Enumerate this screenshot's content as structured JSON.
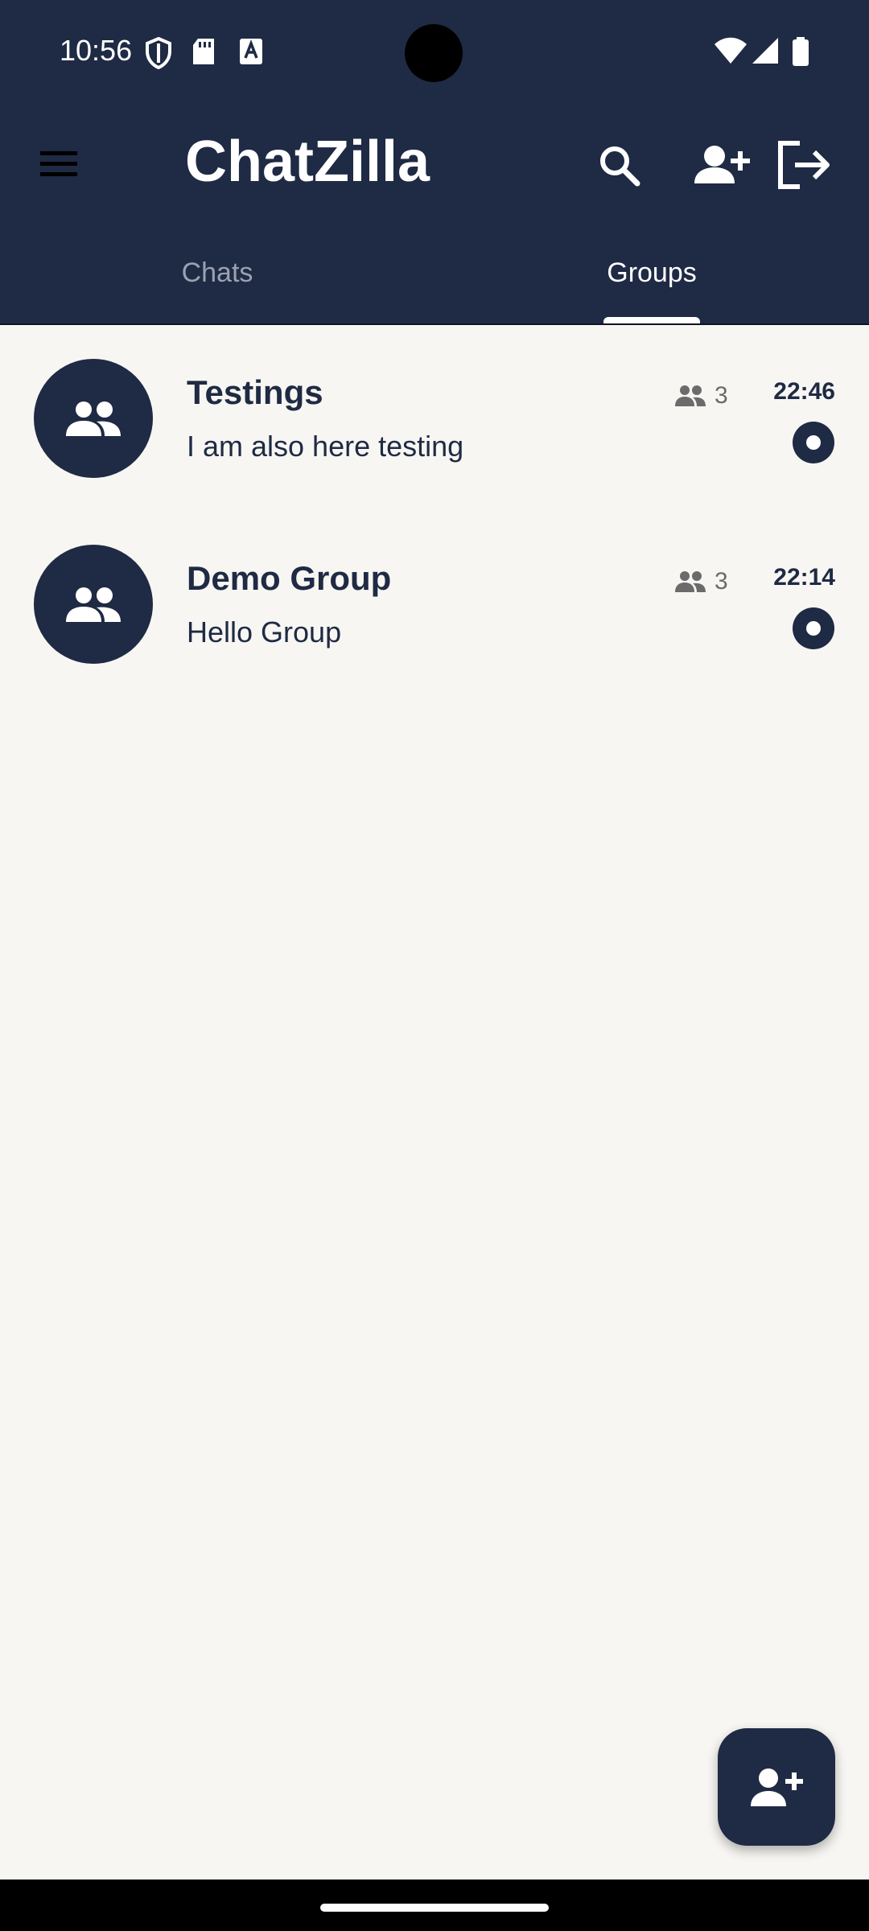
{
  "status_bar": {
    "time": "10:56"
  },
  "app": {
    "title": "ChatZilla"
  },
  "tabs": [
    {
      "label": "Chats",
      "selected": false
    },
    {
      "label": "Groups",
      "selected": true
    }
  ],
  "groups": [
    {
      "name": "Testings",
      "last_message": "I am also here testing",
      "members": "3",
      "time": "22:46",
      "unread": true
    },
    {
      "name": "Demo Group",
      "last_message": "Hello Group",
      "members": "3",
      "time": "22:14",
      "unread": true
    }
  ],
  "colors": {
    "primary": "#1f2a44",
    "background": "#f7f6f2",
    "muted": "#6b6b6b"
  },
  "icons": {
    "menu": "menu-icon",
    "search": "search-icon",
    "add_person": "person-add-icon",
    "logout": "logout-icon",
    "group": "group-icon",
    "fab": "person-add-icon"
  }
}
